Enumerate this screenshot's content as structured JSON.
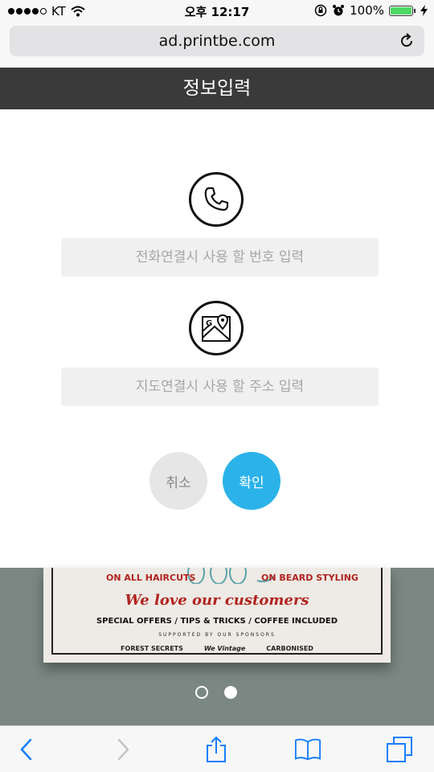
{
  "status_bar": {
    "carrier": "KT",
    "time": "오후 12:17",
    "battery": "100%",
    "icons": [
      "signal-dots-icon",
      "wifi-icon",
      "rotation-lock-icon",
      "alarm-icon",
      "battery-icon",
      "charging-icon"
    ]
  },
  "browser": {
    "url": "ad.printbe.com"
  },
  "page": {
    "title": "정보입력"
  },
  "form": {
    "phone_icon": "phone-icon",
    "phone_placeholder": "전화연결시 사용 할 번호 입력",
    "map_icon": "map-icon",
    "address_placeholder": "지도연결시 사용 할 주소 입력",
    "cancel_label": "취소",
    "confirm_label": "확인"
  },
  "flyer": {
    "left_text": "ON ALL HAIRCUTS",
    "right_text": "ON BEARD STYLING",
    "headline": "We love our customers",
    "subline": "SPECIAL OFFERS / TIPS & TRICKS / COFFEE INCLUDED",
    "sponsor_line": "SUPPORTED BY OUR SPONSORS",
    "sponsors": [
      "FOREST SECRETS",
      "We Vintage",
      "CARBONISED"
    ]
  },
  "carousel": {
    "pages": 2,
    "active_index": 1
  },
  "toolbar": {
    "icons": [
      "back-icon",
      "forward-icon",
      "share-icon",
      "bookmarks-icon",
      "tabs-icon"
    ]
  },
  "colors": {
    "title_bar": "#3a3a3a",
    "confirm_button": "#2bb3e9",
    "cancel_button": "#e6e6e6",
    "ios_blue": "#157efb",
    "battery_green": "#4cd964"
  }
}
